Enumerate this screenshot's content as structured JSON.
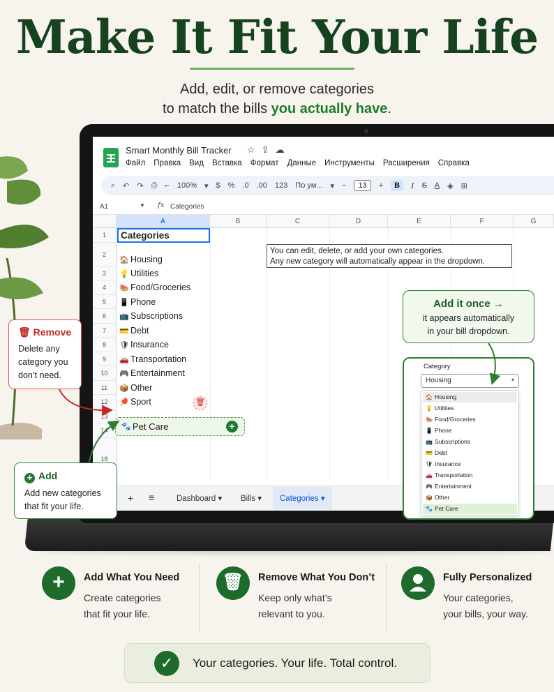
{
  "headline": {
    "title": "Make It Fit Your Life",
    "subtitle_line1": "Add, edit, or remove categories",
    "subtitle_line2_prefix": "to match the bills ",
    "subtitle_line2_accent": "you actually have",
    "subtitle_line2_suffix": "."
  },
  "colors": {
    "brand_green": "#1e6b2b",
    "accent_green": "#1f7a2a",
    "remove_red": "#c62828",
    "selection_blue": "#1a73e8"
  },
  "sheets": {
    "doc_title": "Smart Monthly Bill Tracker",
    "title_icons": [
      "star-icon",
      "folder-move-icon",
      "cloud-icon"
    ],
    "menu": [
      "Файл",
      "Правка",
      "Вид",
      "Вставка",
      "Формат",
      "Данные",
      "Инструменты",
      "Расширения",
      "Справка"
    ],
    "toolbar": {
      "zoom": "100%",
      "currency": "$",
      "percent": "%",
      "dec_minus": ".0",
      "dec_plus": ".00",
      "number_format": "123",
      "font": "По ум...",
      "font_size": "13",
      "bold": "B",
      "italic": "I",
      "strike": "S",
      "text_color": "A"
    },
    "name_box": "A1",
    "formula_value": "Categories",
    "columns": [
      "A",
      "B",
      "C",
      "D",
      "E",
      "F",
      "G"
    ],
    "rows": [
      "1",
      "2",
      "3",
      "4",
      "5",
      "6",
      "7",
      "8",
      "9",
      "10",
      "11",
      "12",
      "13",
      "14",
      "18"
    ],
    "a1_text": "Categories",
    "categories": [
      {
        "icon": "🏠",
        "label": "Housing"
      },
      {
        "icon": "💡",
        "label": "Utilities"
      },
      {
        "icon": "🍉",
        "label": "Food/Groceries"
      },
      {
        "icon": "📱",
        "label": "Phone"
      },
      {
        "icon": "📺",
        "label": "Subscriptions"
      },
      {
        "icon": "💳",
        "label": "Debt"
      },
      {
        "icon": "🛡",
        "label": "Insurance"
      },
      {
        "icon": "🚗",
        "label": "Transportation"
      },
      {
        "icon": "🎮",
        "label": "Entertainment"
      },
      {
        "icon": "📦",
        "label": "Other"
      },
      {
        "icon": "🏓",
        "label": "Sport"
      }
    ],
    "note_line1": "You can edit, delete, or add your own categories.",
    "note_line2": "Any new category will automatically appear in the dropdown.",
    "sheet_tabs": [
      "Dashboard",
      "Bills",
      "Categories"
    ],
    "active_tab": "Categories"
  },
  "pet_care": {
    "icon": "🐾",
    "label": "Pet Care"
  },
  "remove_callout": {
    "title": "Remove",
    "body": "Delete any category you don’t need."
  },
  "add_callout": {
    "title": "Add",
    "body": "Add new categories that fit your life."
  },
  "once_callout": {
    "title": "Add it once →",
    "body_line1": "it appears automatically",
    "body_line2": "in your bill dropdown."
  },
  "dropdown": {
    "label": "Category",
    "selected": "Housing",
    "options": [
      {
        "icon": "🏠",
        "label": "Housing"
      },
      {
        "icon": "💡",
        "label": "Utilities"
      },
      {
        "icon": "🍉",
        "label": "Food/Groceries"
      },
      {
        "icon": "📱",
        "label": "Phone"
      },
      {
        "icon": "📺",
        "label": "Subscriptions"
      },
      {
        "icon": "💳",
        "label": "Debt"
      },
      {
        "icon": "🛡",
        "label": "Insurance"
      },
      {
        "icon": "🚗",
        "label": "Transportation"
      },
      {
        "icon": "🎮",
        "label": "Entertainment"
      },
      {
        "icon": "📦",
        "label": "Other"
      },
      {
        "icon": "🐾",
        "label": "Pet Care"
      }
    ]
  },
  "features": [
    {
      "icon": "plus-icon",
      "title": "Add What You Need",
      "line1": "Create categories",
      "line2": "that fit your life."
    },
    {
      "icon": "trash-icon",
      "title": "Remove What You Don’t",
      "line1": "Keep only what’s",
      "line2": "relevant to you."
    },
    {
      "icon": "user-icon",
      "title": "Fully Personalized",
      "line1": "Your categories,",
      "line2": "your bills, your way."
    }
  ],
  "banner": {
    "text": "Your categories. Your life. Total control."
  }
}
